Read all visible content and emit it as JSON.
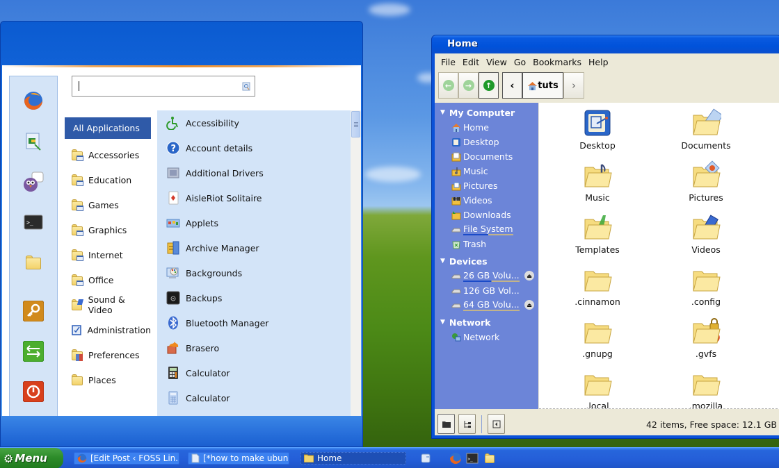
{
  "menu": {
    "search": {
      "placeholder": "",
      "value": ""
    },
    "favorites": [
      {
        "name": "firefox-icon"
      },
      {
        "name": "image-viewer-icon"
      },
      {
        "name": "pidgin-icon"
      },
      {
        "name": "terminal-icon"
      },
      {
        "name": "folder-icon"
      },
      {
        "name": "lock-screen-icon"
      },
      {
        "name": "logout-icon"
      },
      {
        "name": "shutdown-icon"
      }
    ],
    "categories": [
      {
        "label": "All Applications",
        "icon": "none",
        "active": true
      },
      {
        "label": "Accessories",
        "icon": "folder-app"
      },
      {
        "label": "Education",
        "icon": "folder-app"
      },
      {
        "label": "Games",
        "icon": "folder-app"
      },
      {
        "label": "Graphics",
        "icon": "folder-app"
      },
      {
        "label": "Internet",
        "icon": "folder-app"
      },
      {
        "label": "Office",
        "icon": "folder-app"
      },
      {
        "label": "Sound & Video",
        "icon": "folder-media"
      },
      {
        "label": "Administration",
        "icon": "admin"
      },
      {
        "label": "Preferences",
        "icon": "folder-prefs"
      },
      {
        "label": "Places",
        "icon": "folder"
      }
    ],
    "applications": [
      {
        "label": "Accessibility",
        "icon": "accessibility-icon"
      },
      {
        "label": "Account details",
        "icon": "help-icon"
      },
      {
        "label": "Additional Drivers",
        "icon": "drivers-icon"
      },
      {
        "label": "AisleRiot Solitaire",
        "icon": "cards-icon"
      },
      {
        "label": "Applets",
        "icon": "applets-icon"
      },
      {
        "label": "Archive Manager",
        "icon": "archive-icon"
      },
      {
        "label": "Backgrounds",
        "icon": "backgrounds-icon"
      },
      {
        "label": "Backups",
        "icon": "backups-icon"
      },
      {
        "label": "Bluetooth Manager",
        "icon": "bluetooth-icon"
      },
      {
        "label": "Brasero",
        "icon": "brasero-icon"
      },
      {
        "label": "Calculator",
        "icon": "calculator-icon"
      },
      {
        "label": "Calculator",
        "icon": "calculator-alt-icon"
      }
    ]
  },
  "file_manager": {
    "title": "Home",
    "menubar": [
      "File",
      "Edit",
      "View",
      "Go",
      "Bookmarks",
      "Help"
    ],
    "breadcrumb": {
      "current": "tuts"
    },
    "sidebar": {
      "sections": [
        {
          "heading": "My Computer",
          "items": [
            {
              "label": "Home",
              "icon": "home-icon"
            },
            {
              "label": "Desktop",
              "icon": "desktop-icon"
            },
            {
              "label": "Documents",
              "icon": "documents-icon"
            },
            {
              "label": "Music",
              "icon": "music-icon"
            },
            {
              "label": "Pictures",
              "icon": "pictures-icon"
            },
            {
              "label": "Videos",
              "icon": "videos-icon"
            },
            {
              "label": "Downloads",
              "icon": "downloads-icon"
            },
            {
              "label": "File System",
              "icon": "drive-icon",
              "usage": "busy"
            },
            {
              "label": "Trash",
              "icon": "trash-icon"
            }
          ]
        },
        {
          "heading": "Devices",
          "items": [
            {
              "label": "26 GB Volu...",
              "icon": "drive-icon",
              "usage": "busy",
              "eject": true
            },
            {
              "label": "126 GB Vol...",
              "icon": "drive-icon"
            },
            {
              "label": "64 GB Volu...",
              "icon": "drive-icon",
              "usage": "mounted",
              "eject": true
            }
          ]
        },
        {
          "heading": "Network",
          "items": [
            {
              "label": "Network",
              "icon": "network-icon"
            }
          ]
        }
      ]
    },
    "files": [
      {
        "name": "Desktop",
        "icon": "desktop"
      },
      {
        "name": "Documents",
        "icon": "folder-documents"
      },
      {
        "name": "Music",
        "icon": "folder-music"
      },
      {
        "name": "Pictures",
        "icon": "folder-pictures"
      },
      {
        "name": "Templates",
        "icon": "folder-templates"
      },
      {
        "name": "Videos",
        "icon": "folder-videos"
      },
      {
        "name": ".cinnamon",
        "icon": "folder"
      },
      {
        "name": ".config",
        "icon": "folder"
      },
      {
        "name": ".gnupg",
        "icon": "folder"
      },
      {
        "name": ".gvfs",
        "icon": "folder-locked"
      },
      {
        "name": ".local",
        "icon": "folder"
      },
      {
        "name": ".mozilla",
        "icon": "folder"
      }
    ],
    "status": "42 items, Free space: 12.1 GB"
  },
  "taskbar": {
    "menu_label": "Menu",
    "windows": [
      {
        "label": "[Edit Post ‹ FOSS Lin...",
        "icon": "firefox-icon"
      },
      {
        "label": "[*how to make ubun...",
        "icon": "document-icon"
      },
      {
        "label": "Home",
        "icon": "folder-icon",
        "active": true
      }
    ],
    "launchers": [
      "show-desktop-icon",
      "firefox-icon",
      "terminal-icon",
      "folder-icon"
    ]
  },
  "colors": {
    "accent": "#2f5aa8",
    "titlebar": "#0052da",
    "sidebar": "#6c85d8",
    "apps_pane": "#d3e4f8",
    "menu_button": "#2d8c2a"
  }
}
